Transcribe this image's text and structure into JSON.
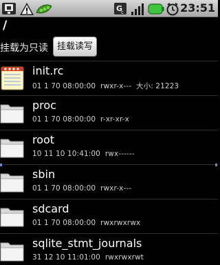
{
  "status_bar": {
    "time": "23:51",
    "icons": [
      "usb-debug-icon",
      "warning-icon",
      "peapod-icon",
      "notification-icon",
      "signal-icon",
      "battery-icon",
      "alarm-icon"
    ]
  },
  "path": "/",
  "mount": {
    "label": "挂载为只读",
    "button_label": "挂载读写"
  },
  "files": [
    {
      "name": "init.rc",
      "date": "01 1 70 08:00:00",
      "perms": "rwxr-x---",
      "size_label": "大小: 21223",
      "icon": "text-file-icon"
    },
    {
      "name": "proc",
      "date": "01 1 70 08:00:00",
      "perms": "r-xr-xr-x",
      "size_label": "",
      "icon": "folder-icon"
    },
    {
      "name": "root",
      "date": "10 11 10 10:41:00",
      "perms": "rwx------",
      "size_label": "",
      "icon": "folder-icon"
    },
    {
      "name": "sbin",
      "date": "01 1 70 08:00:00",
      "perms": "rwxr-x---",
      "size_label": "",
      "icon": "folder-icon"
    },
    {
      "name": "sdcard",
      "date": "01 1 70 08:00:00",
      "perms": "rwxrwxrwx",
      "size_label": "",
      "icon": "folder-icon"
    },
    {
      "name": "sqlite_stmt_journals",
      "date": "31 12 10 11:01:00",
      "perms": "rwxrwxrwt",
      "size_label": "",
      "icon": "folder-icon"
    }
  ],
  "colors": {
    "background": "#000000",
    "status_bar": "#c0c0c0",
    "scroll_marker": "#6f88c8",
    "battery": "#3ec43e"
  }
}
